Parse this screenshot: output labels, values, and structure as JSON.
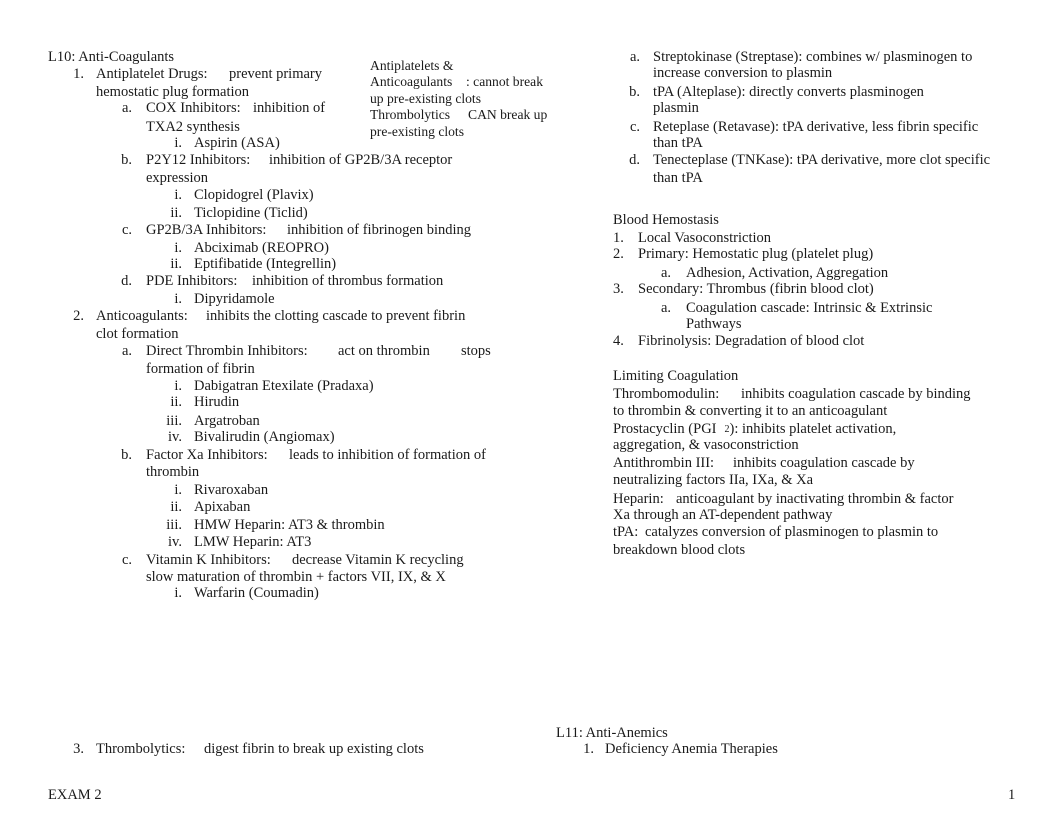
{
  "left": {
    "heading": "L10: Anti-Coagulants",
    "item1": {
      "num": "1.",
      "title": "Antiplatelet Drugs:",
      "desc1": "prevent primary",
      "desc2": "hemostatic plug formation"
    },
    "item1a": {
      "num": "a.",
      "title": "COX Inhibitors:",
      "desc1": "inhibition of",
      "desc2": "TXA2 synthesis",
      "subs": [
        {
          "num": "i.",
          "text": "Aspirin (ASA)"
        }
      ]
    },
    "item1b": {
      "num": "b.",
      "title": "P2Y12 Inhibitors:",
      "desc1": "inhibition of GP2B/3A receptor",
      "desc2": "expression",
      "subs": [
        {
          "num": "i.",
          "text": "Clopidogrel (Plavix)"
        },
        {
          "num": "ii.",
          "text": "Ticlopidine (Ticlid)"
        }
      ]
    },
    "item1c": {
      "num": "c.",
      "title": "GP2B/3A Inhibitors:",
      "desc1": "inhibition of fibrinogen binding",
      "subs": [
        {
          "num": "i.",
          "text": "Abciximab (REOPRO)"
        },
        {
          "num": "ii.",
          "text": "Eptifibatide (Integrellin)"
        }
      ]
    },
    "item1d": {
      "num": "d.",
      "title": "PDE Inhibitors:",
      "desc1": "inhibition of thrombus formation",
      "subs": [
        {
          "num": "i.",
          "text": "Dipyridamole"
        }
      ]
    },
    "item2": {
      "num": "2.",
      "title": "Anticoagulants:",
      "desc1": "inhibits the clotting cascade to prevent fibrin",
      "desc2": "clot formation"
    },
    "item2a": {
      "num": "a.",
      "title": "Direct Thrombin Inhibitors:",
      "desc1": "act on thrombin",
      "desc3": "stops",
      "desc2": "formation of fibrin",
      "subs": [
        {
          "num": "i.",
          "text": "Dabigatran Etexilate (Pradaxa)"
        },
        {
          "num": "ii.",
          "text": "Hirudin"
        },
        {
          "num": "iii.",
          "text": "Argatroban"
        },
        {
          "num": "iv.",
          "text": "Bivalirudin (Angiomax)"
        }
      ]
    },
    "item2b": {
      "num": "b.",
      "title": "Factor Xa Inhibitors:",
      "desc1": "leads to inhibition of formation of",
      "desc2": "thrombin",
      "subs": [
        {
          "num": "i.",
          "text": "Rivaroxaban"
        },
        {
          "num": "ii.",
          "text": "Apixaban"
        },
        {
          "num": "iii.",
          "text": "HMW Heparin: AT3 & thrombin"
        },
        {
          "num": "iv.",
          "text": "LMW Heparin: AT3"
        }
      ]
    },
    "item2c": {
      "num": "c.",
      "title": "Vitamin K Inhibitors:",
      "desc1": "decrease Vitamin K recycling",
      "desc2": "slow maturation of thrombin + factors VII, IX, & X",
      "subs": [
        {
          "num": "i.",
          "text": "Warfarin (Coumadin)"
        }
      ]
    },
    "item3": {
      "num": "3.",
      "title": "Thrombolytics:",
      "desc1": "digest fibrin to break up existing clots"
    }
  },
  "sidenote": {
    "line1": "Antiplatelets &",
    "line2a": "Anticoagulants",
    "line2b": ": cannot break",
    "line3": "up pre-existing clots",
    "line4a": "Thrombolytics",
    "line4b": "CAN break up",
    "line5": "pre-existing clots"
  },
  "right": {
    "thrombolytics": [
      {
        "num": "a.",
        "line1": "Streptokinase (Streptase): combines w/ plasminogen to",
        "line2": "increase conversion to plasmin"
      },
      {
        "num": "b.",
        "line1": "tPA (Alteplase): directly converts plasminogen",
        "line2": "plasmin"
      },
      {
        "num": "c.",
        "line1": "Reteplase (Retavase): tPA derivative, less fibrin specific",
        "line2": "than tPA"
      },
      {
        "num": "d.",
        "line1": "Tenecteplase (TNKase): tPA derivative, more clot specific",
        "line2": "than tPA"
      }
    ],
    "hemostasis": {
      "heading": "Blood Hemostasis",
      "items": [
        {
          "num": "1.",
          "text": "Local Vasoconstriction"
        },
        {
          "num": "2.",
          "text": "Primary: Hemostatic plug (platelet plug)"
        },
        {
          "num": "a.",
          "text": "Adhesion, Activation, Aggregation"
        },
        {
          "num": "3.",
          "text": "Secondary: Thrombus (fibrin blood clot)"
        },
        {
          "num": "a.",
          "text": "Coagulation cascade: Intrinsic & Extrinsic",
          "text2": "Pathways"
        },
        {
          "num": "4.",
          "text": "Fibrinolysis: Degradation of blood clot"
        }
      ]
    },
    "limiting": {
      "heading": "Limiting Coagulation",
      "thrombomodulin": {
        "title": "Thrombomodulin:",
        "line1": "inhibits coagulation cascade by binding",
        "line2": "to thrombin & converting it to an anticoagulant"
      },
      "prostacyclin": {
        "title": "Prostacyclin (PGI",
        "sub": "2",
        "line1": "): inhibits platelet activation,",
        "line2": "aggregation, & vasoconstriction"
      },
      "antithrombin": {
        "title": "Antithrombin III:",
        "line1": "inhibits coagulation cascade by",
        "line2": "neutralizing factors IIa, IXa, & Xa"
      },
      "heparin": {
        "title": "Heparin:",
        "line1": "anticoagulant by inactivating thrombin & factor",
        "line2": "Xa through an AT-dependent pathway"
      },
      "tpa": {
        "title": "tPA:",
        "line1": "catalyzes conversion of plasminogen to plasmin to",
        "line2": "breakdown blood clots"
      }
    },
    "l11": {
      "heading": "L11: Anti-Anemics",
      "item1": {
        "num": "1.",
        "text": "Deficiency Anemia Therapies"
      }
    }
  },
  "footer": {
    "left": "EXAM 2",
    "page": "1"
  }
}
